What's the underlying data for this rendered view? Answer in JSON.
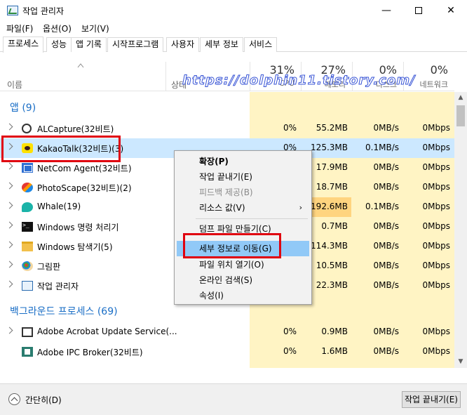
{
  "window": {
    "title": "작업 관리자",
    "min": "—",
    "close": "✕"
  },
  "menu": [
    "파일(F)",
    "옵션(O)",
    "보기(V)"
  ],
  "tabs": [
    "프로세스",
    "성능",
    "앱 기록",
    "시작프로그램",
    "사용자",
    "세부 정보",
    "서비스"
  ],
  "header": {
    "name": "이름",
    "status": "상태",
    "cpu_pct": "31%",
    "mem_pct": "27%",
    "disk_pct": "0%",
    "net_pct": "0%",
    "cpu_label": "CPU",
    "mem_label": "메모리",
    "disk_label": "디스크",
    "net_label": "네트워크",
    "watermark": "https://dolphin11.tistory.com/"
  },
  "groups": {
    "apps": "앱 (9)",
    "background": "백그라운드 프로세스 (69)"
  },
  "apps": [
    {
      "name": "ALCapture(32비트)",
      "cpu": "0%",
      "mem": "55.2MB",
      "disk": "0MB/s",
      "net": "0Mbps"
    },
    {
      "name": "KakaoTalk(32비트)(3)",
      "cpu": "0%",
      "mem": "125.3MB",
      "disk": "0.1MB/s",
      "net": "0Mbps"
    },
    {
      "name": "NetCom Agent(32비트)",
      "cpu": "",
      "mem": "17.9MB",
      "disk": "0MB/s",
      "net": "0Mbps"
    },
    {
      "name": "PhotoScape(32비트)(2)",
      "cpu": "",
      "mem": "18.7MB",
      "disk": "0MB/s",
      "net": "0Mbps"
    },
    {
      "name": "Whale(19)",
      "cpu": "",
      "mem": "192.6MB",
      "disk": "0.1MB/s",
      "net": "0Mbps"
    },
    {
      "name": "Windows 명령 처리기",
      "cpu": "",
      "mem": "0.7MB",
      "disk": "0MB/s",
      "net": "0Mbps"
    },
    {
      "name": "Windows 탐색기(5)",
      "cpu": "",
      "mem": "114.3MB",
      "disk": "0MB/s",
      "net": "0Mbps"
    },
    {
      "name": "그림판",
      "cpu": "",
      "mem": "10.5MB",
      "disk": "0MB/s",
      "net": "0Mbps"
    },
    {
      "name": "작업 관리자",
      "cpu": "",
      "mem": "22.3MB",
      "disk": "0MB/s",
      "net": "0Mbps"
    }
  ],
  "background": [
    {
      "name": "Adobe Acrobat Update Service(...",
      "cpu": "0%",
      "mem": "0.9MB",
      "disk": "0MB/s",
      "net": "0Mbps"
    },
    {
      "name": "Adobe IPC Broker(32비트)",
      "cpu": "0%",
      "mem": "1.6MB",
      "disk": "0MB/s",
      "net": "0Mbps"
    }
  ],
  "context_menu": {
    "expand": "확장(P)",
    "end_task": "작업 끝내기(E)",
    "feedback": "피드백 제공(B)",
    "resource_values": "리소스 값(V)",
    "dump": "덤프 파일 만들기(C)",
    "go_details": "세부 정보로 이동(G)",
    "open_location": "파일 위치 열기(O)",
    "search_online": "온라인 검색(S)",
    "properties": "속성(I)",
    "submenu_arrow": "›"
  },
  "footer": {
    "fewer": "간단히(D)",
    "end_task": "작업 끝내기(E)"
  },
  "colors": {
    "highlight_red": "#e0000f",
    "selection": "#cce8ff",
    "menu_hover": "#91c9f7",
    "group_blue": "#1a6ec6"
  }
}
